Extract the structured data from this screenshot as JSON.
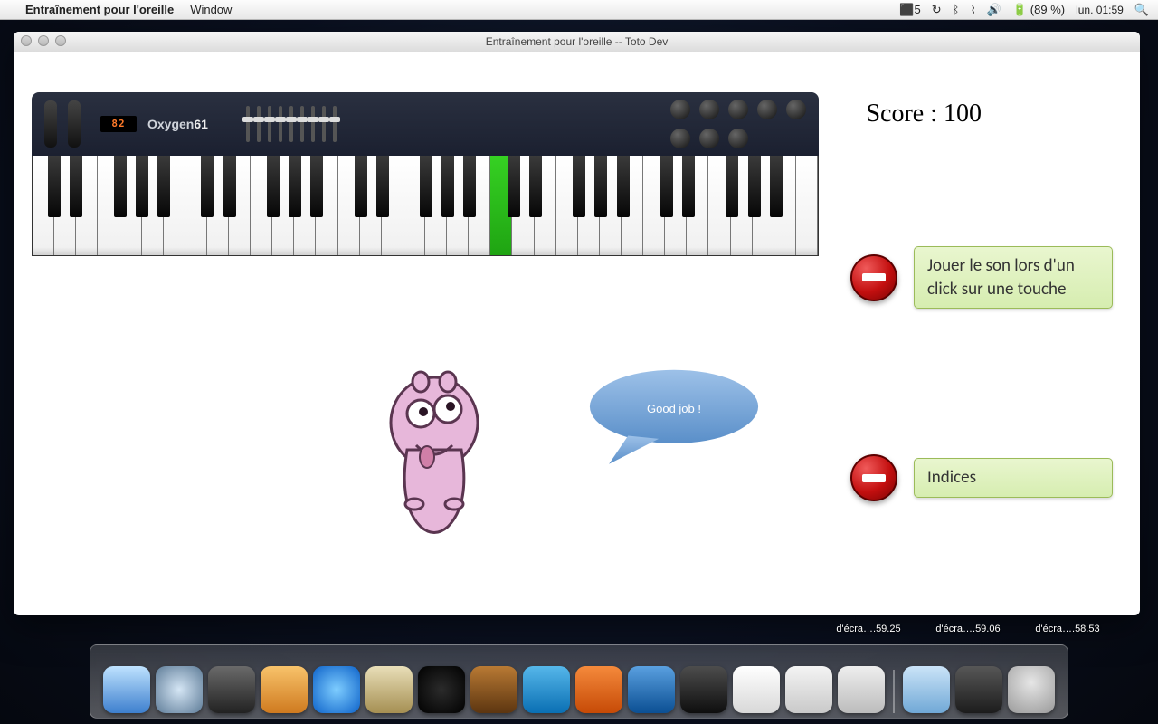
{
  "menubar": {
    "app_name": "Entraînement pour l'oreille",
    "menu_window": "Window",
    "adobe": "5",
    "battery": "(89 %)",
    "clock": "lun. 01:59"
  },
  "window": {
    "title": "Entraînement pour l'oreille -- Toto Dev"
  },
  "keyboard": {
    "lcd": "82",
    "brand": "Oxygen",
    "brand_suffix": "61",
    "highlighted_white_key_index": 21,
    "white_key_count": 36
  },
  "score": {
    "label": "Score :",
    "value": "100"
  },
  "options": {
    "play_on_click": "Jouer le son lors d'un click sur une touche",
    "hints": "Indices"
  },
  "bubble": {
    "text": "Good job !"
  },
  "desktop_labels": [
    "d'écra….59.25",
    "d'écra….59.06",
    "d'écra….58.53"
  ]
}
